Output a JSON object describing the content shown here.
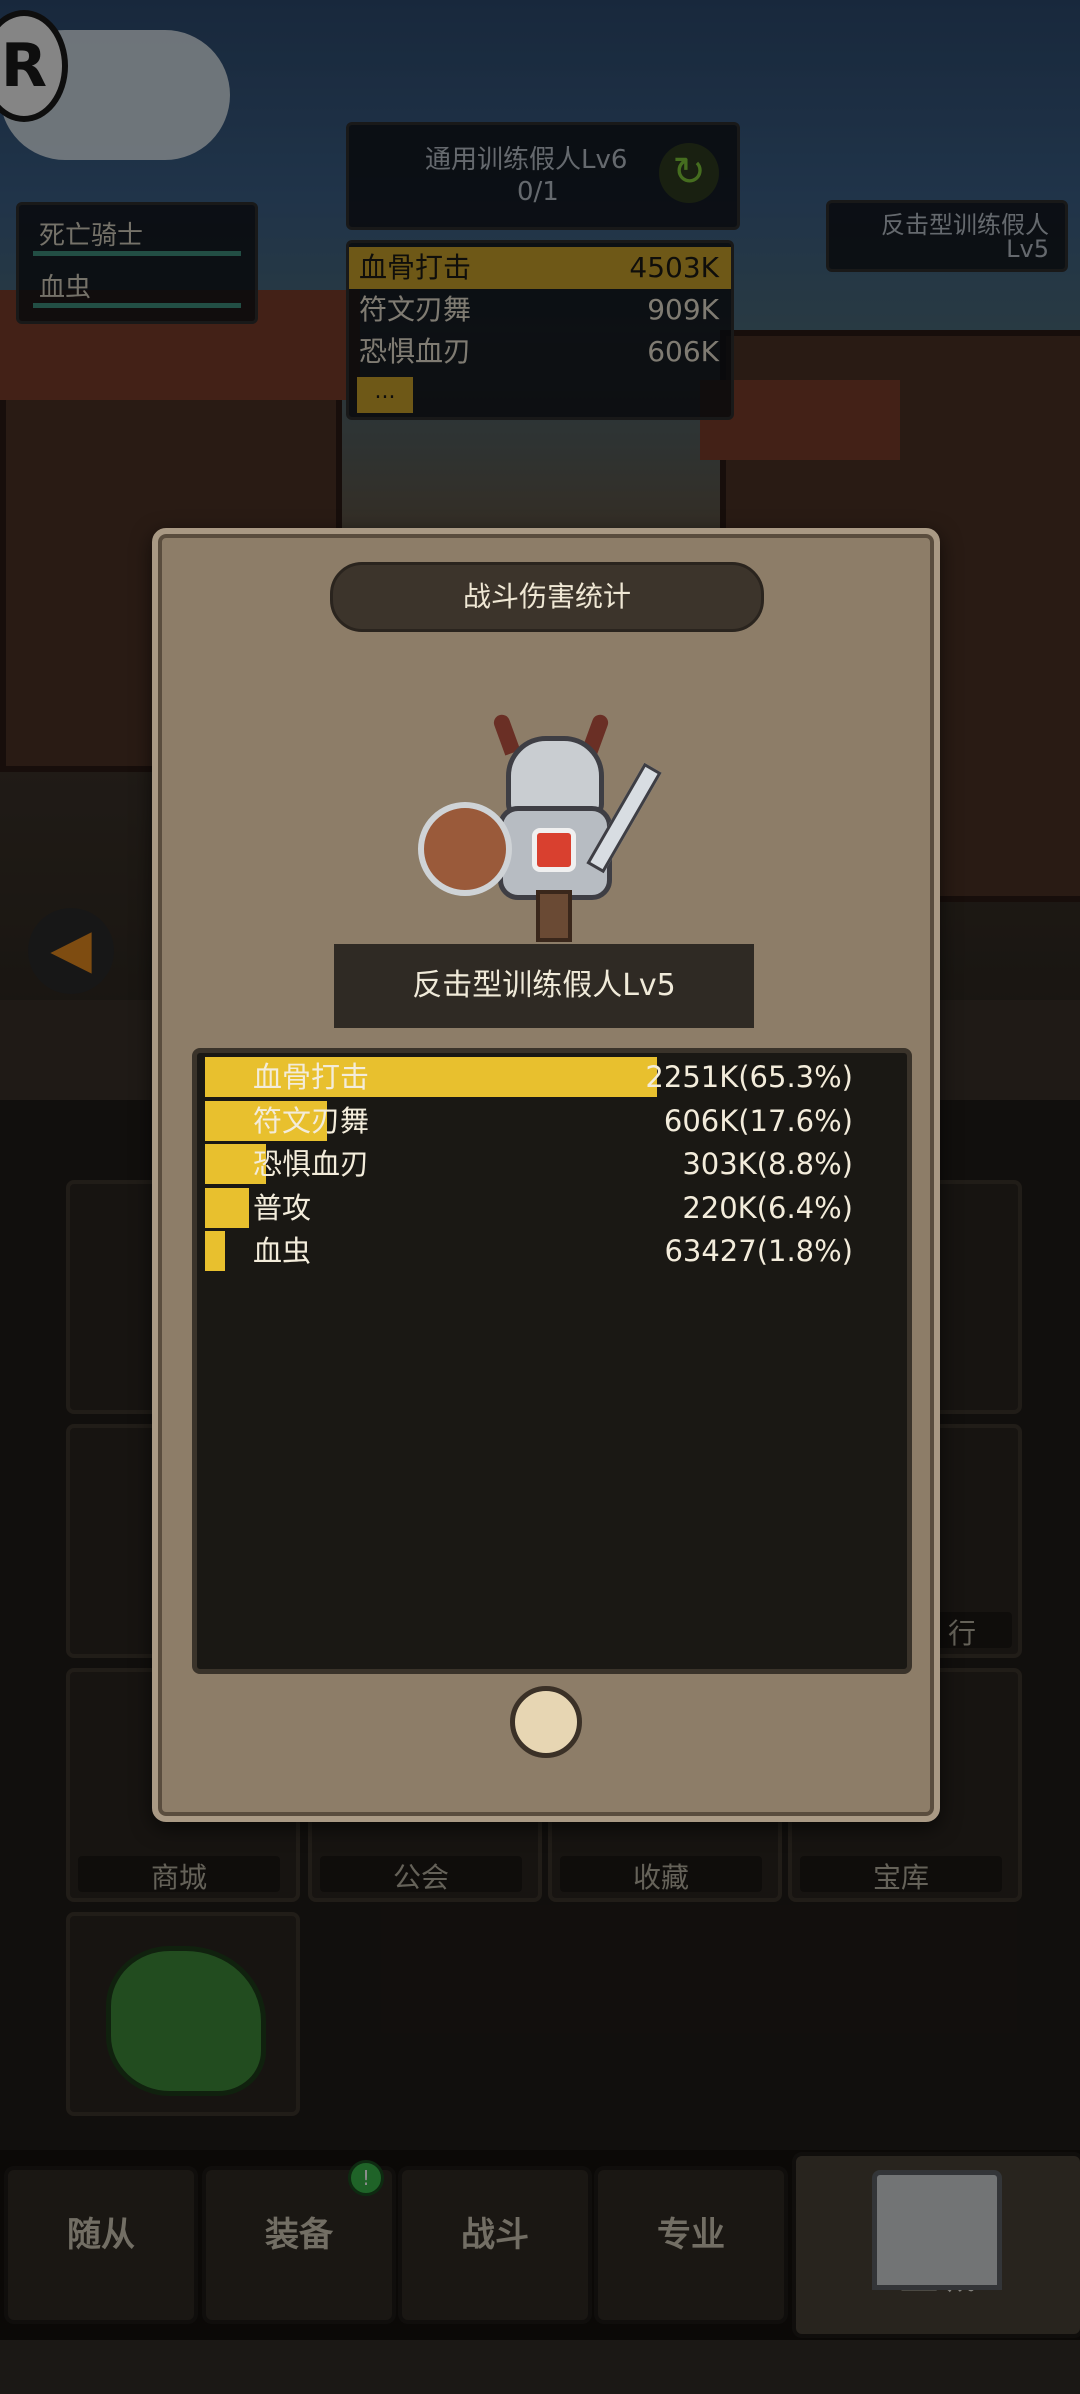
{
  "hud": {
    "boss_title": "通用训练假人Lv6",
    "boss_progress": "0/1",
    "left_units": [
      "死亡骑士",
      "血虫"
    ],
    "right_target": "反击型训练假人",
    "right_target_level": "Lv5",
    "damage_list": [
      {
        "name": "血骨打击",
        "value": "4503K"
      },
      {
        "name": "符文刃舞",
        "value": "909K"
      },
      {
        "name": "恐惧血刃",
        "value": "606K"
      }
    ],
    "more_label": "..."
  },
  "modal": {
    "title": "战斗伤害统计",
    "boss_name": "反击型训练假人Lv5",
    "stats": [
      {
        "name": "血骨打击",
        "value": "2251K(65.3%)",
        "share": 0.653
      },
      {
        "name": "符文刃舞",
        "value": "606K(17.6%)",
        "share": 0.176
      },
      {
        "name": "恐惧血刃",
        "value": "303K(8.8%)",
        "share": 0.088
      },
      {
        "name": "普攻",
        "value": "220K(6.4%)",
        "share": 0.064
      },
      {
        "name": "血虫",
        "value": "63427(1.8%)",
        "share": 0.018
      }
    ]
  },
  "grid_captions": [
    "商城",
    "公会",
    "收藏",
    "宝库"
  ],
  "partial_caption": "行",
  "nav": [
    "随从",
    "装备",
    "战斗",
    "专业",
    "主城"
  ],
  "colors": {
    "bar": "#e8c02e",
    "hp": "#3f8f7d",
    "badge": "#39b54a"
  }
}
